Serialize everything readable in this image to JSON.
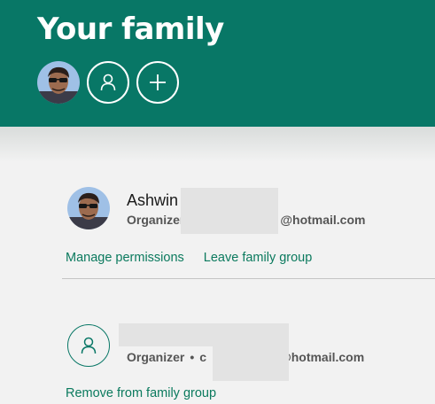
{
  "header": {
    "title": "Your family",
    "member_avatar": "user-photo",
    "add_member_icon": "plus-icon",
    "generic_member_icon": "person-icon"
  },
  "members": [
    {
      "name": "Ashwin",
      "role": "Organizer",
      "email_suffix": "@hotmail.com",
      "avatar": "user-photo",
      "actions": [
        "Manage permissions",
        "Leave family group"
      ]
    },
    {
      "name": "",
      "role": "Organizer",
      "email_prefix": "c",
      "email_suffix": "@hotmail.com",
      "avatar": "person-icon",
      "actions": [
        "Remove from family group"
      ]
    }
  ],
  "colors": {
    "header_bg": "#087766",
    "link": "#0b7a5e",
    "page_bg": "#f2f2f2"
  }
}
